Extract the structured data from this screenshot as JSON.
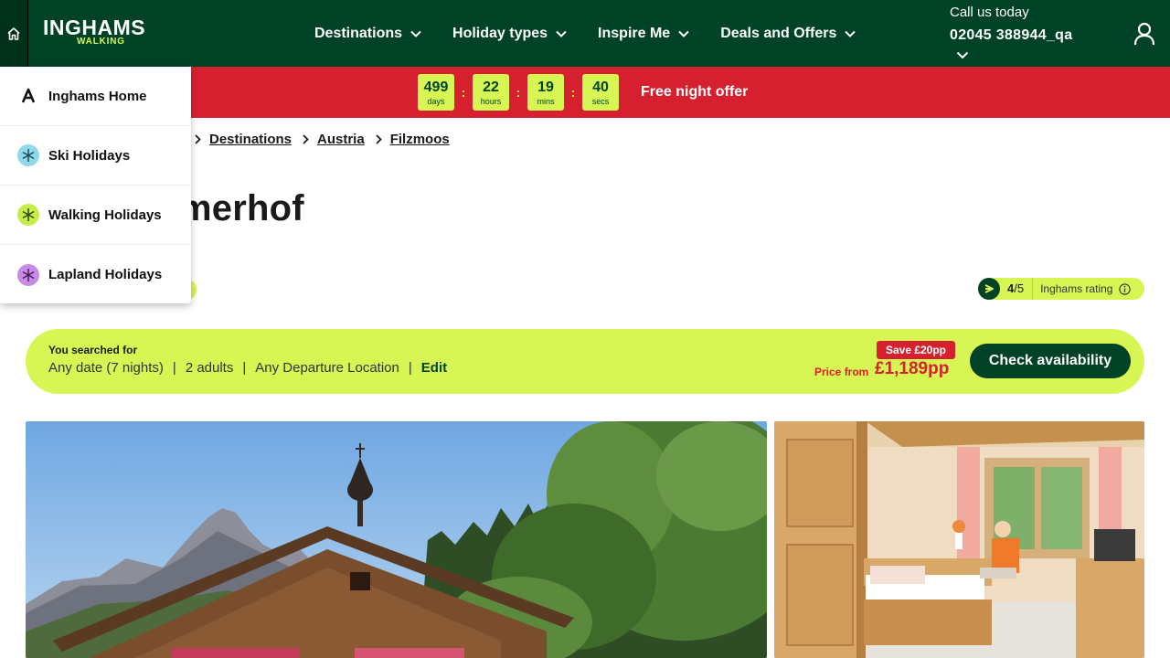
{
  "header": {
    "logo_main": "INGHAMS",
    "logo_sub": "WALKING",
    "nav": [
      {
        "label": "Destinations"
      },
      {
        "label": "Holiday types"
      },
      {
        "label": "Inspire Me"
      },
      {
        "label": "Deals and Offers"
      }
    ],
    "call_label": "Call us today",
    "call_number": "02045 388944_qa"
  },
  "promo": {
    "countdown": [
      {
        "value": "499",
        "unit": "days"
      },
      {
        "value": "22",
        "unit": "hours"
      },
      {
        "value": "19",
        "unit": "mins"
      },
      {
        "value": "40",
        "unit": "secs"
      }
    ],
    "separator": ":",
    "offer_text": "Free night offer"
  },
  "breadcrumb": [
    "Destinations",
    "Austria",
    "Filzmoos"
  ],
  "property": {
    "title_visible": "merhof"
  },
  "rating": {
    "score": "4",
    "out_of": "/5",
    "label": "Inghams rating"
  },
  "search": {
    "label": "You searched for",
    "date": "Any date (7 nights)",
    "guests": "2 adults",
    "departure": "Any Departure Location",
    "separator": "|",
    "edit_label": "Edit",
    "save_badge": "Save £20pp",
    "price_from_label": "Price from",
    "price": "£1,189pp",
    "cta_label": "Check availability"
  },
  "dropdown": {
    "items": [
      {
        "label": "Inghams Home",
        "icon": "inghams-logo-icon",
        "color": "#111111"
      },
      {
        "label": "Ski Holidays",
        "icon": "snowflake-icon",
        "color": "#7fd3e6"
      },
      {
        "label": "Walking Holidays",
        "icon": "walking-icon",
        "color": "#b8e03a"
      },
      {
        "label": "Lapland Holidays",
        "icon": "lapland-icon",
        "color": "#c17be0"
      }
    ]
  },
  "colors": {
    "brand_green": "#004225",
    "accent_lime": "#d7f553",
    "promo_red": "#d7202f"
  }
}
